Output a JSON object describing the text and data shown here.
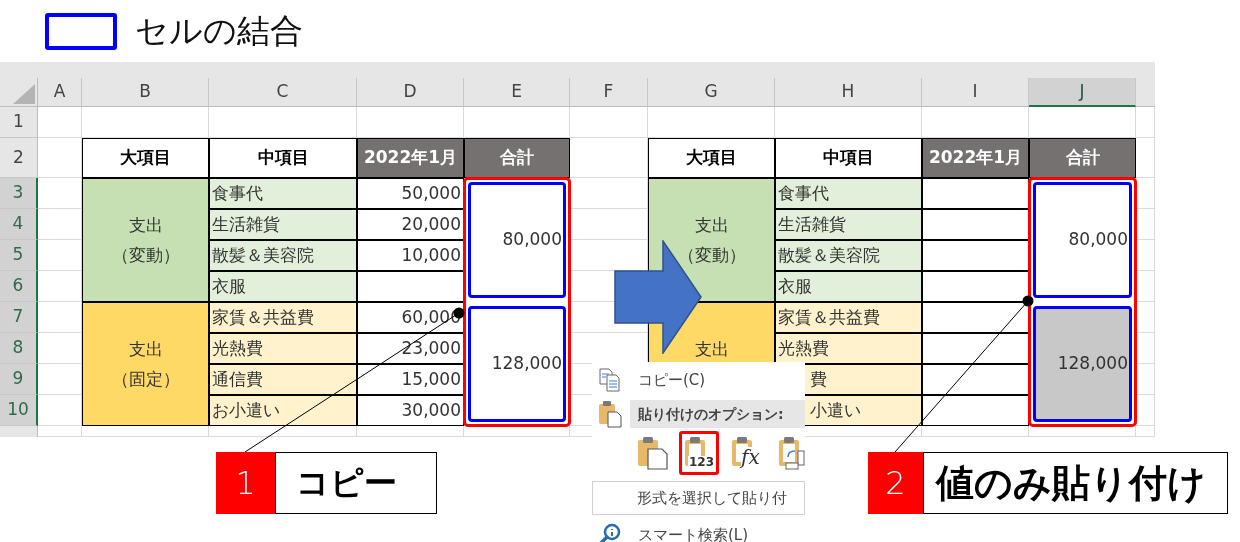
{
  "legend": {
    "label": "セルの結合"
  },
  "sheet": {
    "columns": [
      {
        "label": "A",
        "selected": false
      },
      {
        "label": "B",
        "selected": false
      },
      {
        "label": "C",
        "selected": false
      },
      {
        "label": "D",
        "selected": false
      },
      {
        "label": "E",
        "selected": false
      },
      {
        "label": "F",
        "selected": false
      },
      {
        "label": "G",
        "selected": false
      },
      {
        "label": "H",
        "selected": false
      },
      {
        "label": "I",
        "selected": false
      },
      {
        "label": "J",
        "selected": true
      }
    ],
    "rows": [
      {
        "label": "1",
        "selected": false
      },
      {
        "label": "2",
        "selected": false
      },
      {
        "label": "3",
        "selected": true
      },
      {
        "label": "4",
        "selected": true
      },
      {
        "label": "5",
        "selected": true
      },
      {
        "label": "6",
        "selected": true
      },
      {
        "label": "7",
        "selected": true
      },
      {
        "label": "8",
        "selected": true
      },
      {
        "label": "9",
        "selected": true
      },
      {
        "label": "10",
        "selected": true
      }
    ],
    "tables": [
      {
        "headers": [
          {
            "label": "大項目",
            "kind": "plain"
          },
          {
            "label": "中項目",
            "kind": "plain"
          },
          {
            "label": "2022年1月",
            "kind": "dark"
          },
          {
            "label": "合計",
            "kind": "dark"
          }
        ],
        "groups": [
          {
            "label_lines": [
              "支出",
              "（変動）"
            ],
            "color": "#c6e0b4",
            "total": "80,000",
            "shaded": false,
            "items": [
              {
                "name": "食事代",
                "value": "50,000",
                "color": "#e2efda"
              },
              {
                "name": "生活雑貨",
                "value": "20,000",
                "color": "#e2efda"
              },
              {
                "name": "散髪＆美容院",
                "value": "10,000",
                "color": "#e2efda"
              },
              {
                "name": "衣服",
                "color": "#e2efda"
              }
            ]
          },
          {
            "label_lines": [
              "支出",
              "（固定）"
            ],
            "color": "#ffd966",
            "total": "128,000",
            "shaded": false,
            "items": [
              {
                "name": "家賃＆共益費",
                "value": "60,000",
                "color": "#fff2cc"
              },
              {
                "name": "光熱費",
                "value": "23,000",
                "color": "#fff2cc"
              },
              {
                "name": "通信費",
                "value": "15,000",
                "color": "#fff2cc"
              },
              {
                "name": "お小遣い",
                "value": "30,000",
                "color": "#fff2cc"
              }
            ]
          }
        ]
      },
      {
        "headers": [
          {
            "label": "大項目",
            "kind": "plain"
          },
          {
            "label": "中項目",
            "kind": "plain"
          },
          {
            "label": "2022年1月",
            "kind": "dark"
          },
          {
            "label": "合計",
            "kind": "dark"
          }
        ],
        "groups": [
          {
            "label_lines": [
              "支出",
              "（変動）"
            ],
            "color": "#c6e0b4",
            "total": "80,000",
            "shaded": false,
            "items": [
              {
                "name": "食事代",
                "color": "#e2efda"
              },
              {
                "name": "生活雑貨",
                "color": "#e2efda"
              },
              {
                "name": "散髪＆美容院",
                "color": "#e2efda"
              },
              {
                "name": "衣服",
                "color": "#e2efda"
              }
            ]
          },
          {
            "label_lines": [
              "支出"
            ],
            "color": "#ffd966",
            "total": "128,000",
            "shaded": true,
            "items": [
              {
                "name": "家賃＆共益費",
                "color": "#fff2cc"
              },
              {
                "name": "光熱費",
                "color": "#fff2cc"
              },
              {
                "name": "費",
                "partly_covered": true,
                "color": "#fff2cc"
              },
              {
                "name": "小遣い",
                "partly_covered": true,
                "color": "#fff2cc"
              }
            ]
          }
        ]
      }
    ]
  },
  "context_menu": {
    "copy": {
      "label": "コピー(C)",
      "selected": false
    },
    "paste_header": "貼り付けのオプション:",
    "paste_options": [
      {
        "kind": "paste",
        "selected": false
      },
      {
        "kind": "values",
        "label": "123",
        "selected": true
      },
      {
        "kind": "formulas",
        "label": "fx",
        "selected": false
      },
      {
        "kind": "transpose",
        "selected": false
      }
    ],
    "paste_special": {
      "label": "形式を選択して貼り付",
      "selected": true
    },
    "smart_lookup": {
      "label": "スマート検索(L)",
      "selected": false
    }
  },
  "steps": [
    {
      "number": "1",
      "label": "コピー"
    },
    {
      "number": "2",
      "label": "値のみ貼り付け"
    }
  ]
}
